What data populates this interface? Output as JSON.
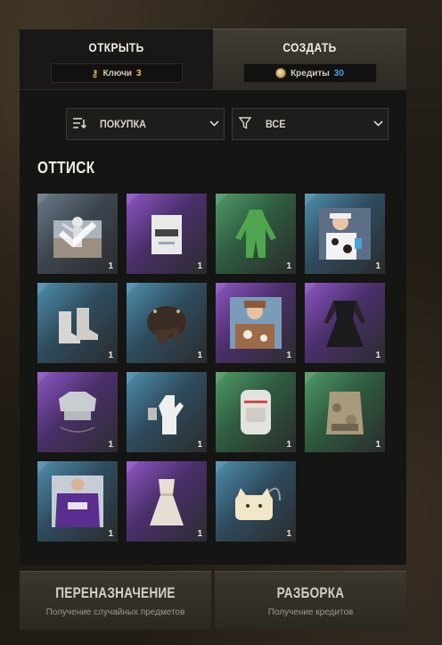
{
  "tabs": {
    "open": {
      "label": "ОТКРЫТЬ",
      "currency_label": "Ключи",
      "currency_value": "3"
    },
    "create": {
      "label": "СОЗДАТЬ",
      "currency_label": "Кредиты",
      "currency_value": "30"
    }
  },
  "filters": {
    "sort": {
      "value": "ПОКУПКА",
      "icon": "sort-icon"
    },
    "type": {
      "value": "ВСЕ",
      "icon": "filter-funnel-icon"
    }
  },
  "section": {
    "title": "ОТТИСК"
  },
  "items": [
    {
      "name": "emote-skin",
      "count": "1",
      "rarity": "slate",
      "selected": true
    },
    {
      "name": "white-helmet",
      "count": "1",
      "rarity": "purple"
    },
    {
      "name": "green-onesie",
      "count": "1",
      "rarity": "green"
    },
    {
      "name": "cow-print-outfit",
      "count": "1",
      "rarity": "blue"
    },
    {
      "name": "white-boots",
      "count": "1",
      "rarity": "blue"
    },
    {
      "name": "spiked-helmet",
      "count": "1",
      "rarity": "blue"
    },
    {
      "name": "brown-fur-outfit",
      "count": "1",
      "rarity": "purple"
    },
    {
      "name": "black-dress",
      "count": "1",
      "rarity": "purple"
    },
    {
      "name": "chrome-crop-top",
      "count": "1",
      "rarity": "purple"
    },
    {
      "name": "white-gloves",
      "count": "1",
      "rarity": "blue"
    },
    {
      "name": "white-backpack",
      "count": "1",
      "rarity": "green"
    },
    {
      "name": "camo-vest",
      "count": "1",
      "rarity": "green"
    },
    {
      "name": "purple-hoodie",
      "count": "1",
      "rarity": "blue"
    },
    {
      "name": "white-dress",
      "count": "1",
      "rarity": "purple"
    },
    {
      "name": "cat-bag",
      "count": "1",
      "rarity": "blue"
    }
  ],
  "actions": {
    "reassign": {
      "title": "ПЕРЕНАЗНАЧЕНИЕ",
      "subtitle": "Получение случайных предметов"
    },
    "dismantle": {
      "title": "РАЗБОРКА",
      "subtitle": "Получение кредитов"
    }
  },
  "colors": {
    "keys": "#f0c238",
    "credits": "#3ea6e8",
    "rarity_purple": "#7a4aa6",
    "rarity_blue": "#3d6d86",
    "rarity_green": "#3f7b55",
    "rarity_slate": "#5a6672"
  }
}
